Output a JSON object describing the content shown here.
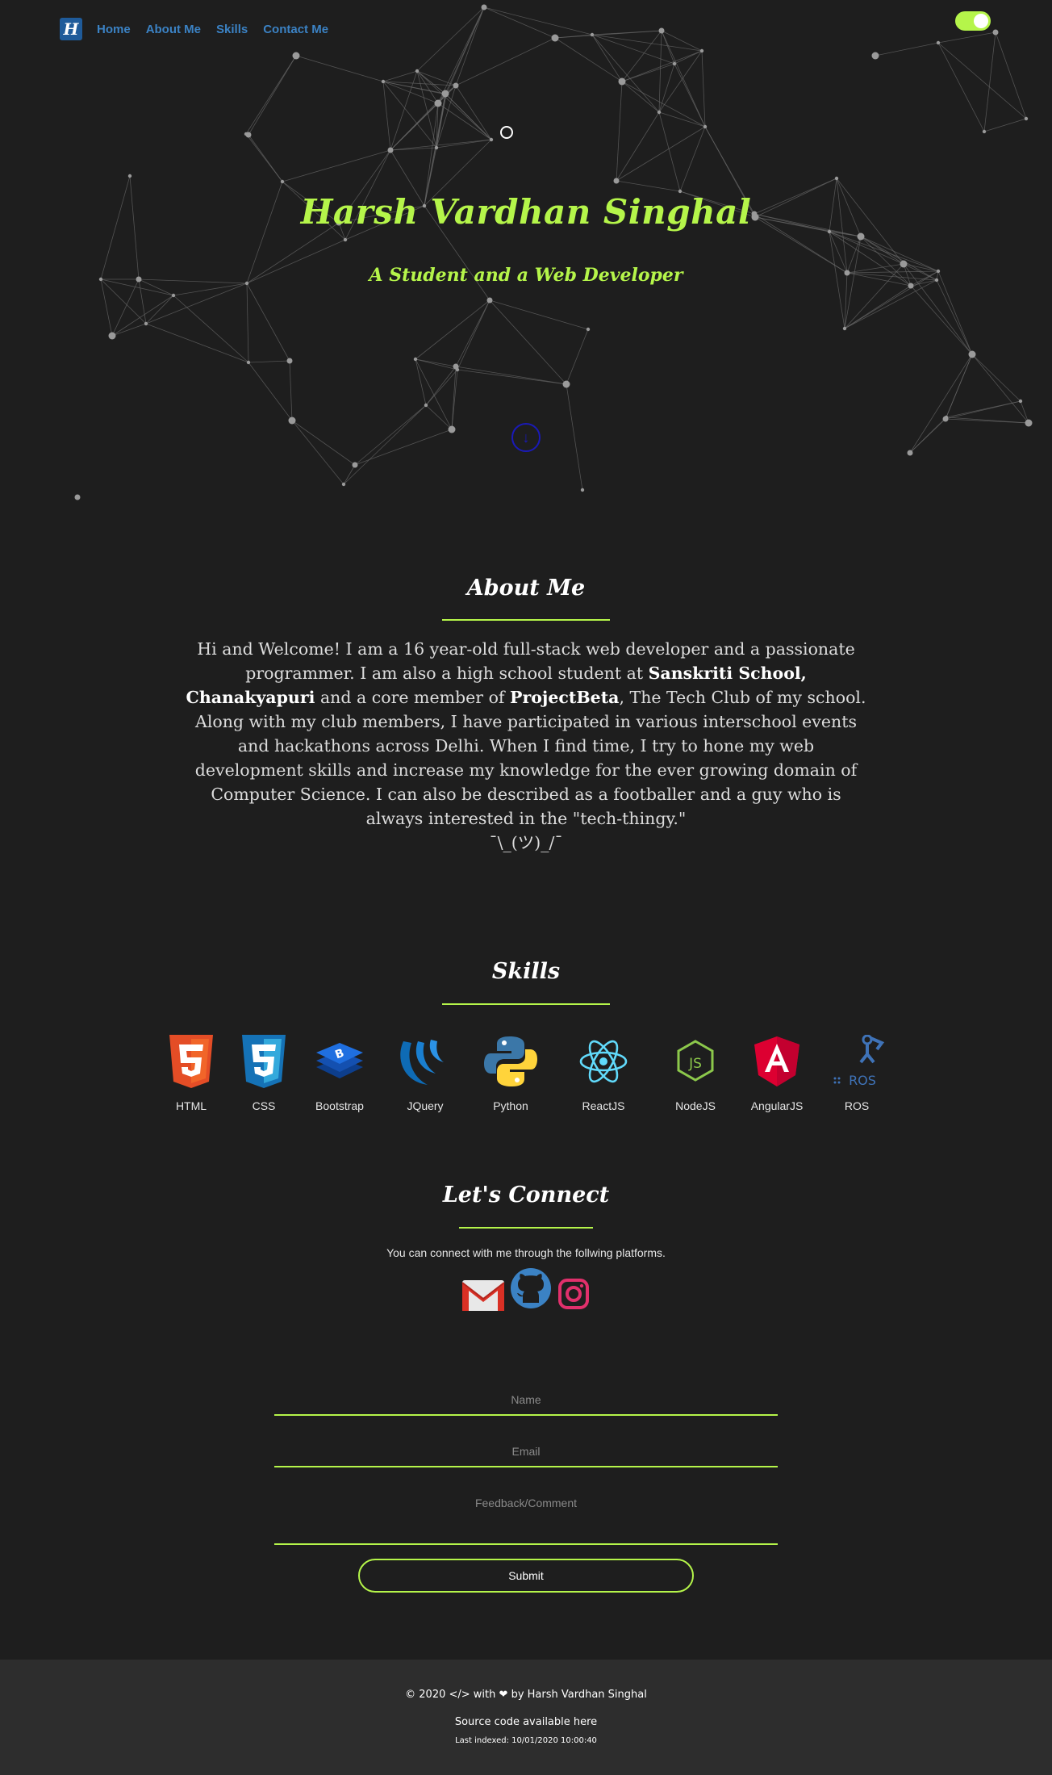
{
  "nav": {
    "logo_text": "H",
    "links": [
      "Home",
      "About Me",
      "Skills",
      "Contact Me"
    ]
  },
  "theme_toggle": {
    "state": "on",
    "color": "#b5f54a"
  },
  "hero": {
    "title": "Harsh Vardhan Singhal",
    "subtitle": "A Student and a Web Developer",
    "scroll_icon": "chevron-down-icon"
  },
  "about": {
    "heading": "About Me",
    "p1": "Hi and Welcome! I am a 16 year-old full-stack web developer and a passionate programmer. I am also a high school student at ",
    "school": "Sanskriti School, Chanakyapuri",
    "p2": " and a core member of ",
    "club": "ProjectBeta",
    "p3": ", The Tech Club of my school. Along with my club members, I have participated in various interschool events and hackathons across Delhi. When I find time, I try to hone my web development skills and increase my knowledge for the ever growing domain of Computer Science. I can also be described as a footballer and a guy who is always interested in the \"tech-thingy.\"",
    "shrug": "¯\\_(ツ)_/¯"
  },
  "skills": {
    "heading": "Skills",
    "items": [
      {
        "label": "HTML",
        "icon": "html5-icon"
      },
      {
        "label": "CSS",
        "icon": "css3-icon"
      },
      {
        "label": "Bootstrap",
        "icon": "bootstrap-icon"
      },
      {
        "label": "JQuery",
        "icon": "jquery-icon"
      },
      {
        "label": "Python",
        "icon": "python-icon"
      },
      {
        "label": "ReactJS",
        "icon": "react-icon"
      },
      {
        "label": "NodeJS",
        "icon": "nodejs-icon"
      },
      {
        "label": "AngularJS",
        "icon": "angular-icon"
      },
      {
        "label": "ROS",
        "icon": "ros-icon"
      }
    ]
  },
  "connect": {
    "heading": "Let's Connect",
    "text": "You can connect with me through the follwing platforms.",
    "platforms": [
      "gmail-icon",
      "github-icon",
      "instagram-icon"
    ]
  },
  "form": {
    "name_placeholder": "Name",
    "email_placeholder": "Email",
    "comment_placeholder": "Feedback/Comment",
    "submit_label": "Submit"
  },
  "footer": {
    "credit_prefix": "© 2020 </> with",
    "credit_suffix": "by Harsh Vardhan Singhal",
    "source": "Source code available here",
    "indexed": "Last indexed: 10/01/2020 10:00:40"
  },
  "colors": {
    "accent": "#b5f54a",
    "background": "#1e1e1e",
    "footer_bg": "#2d2d2d",
    "nav_link": "#3b82c4"
  }
}
